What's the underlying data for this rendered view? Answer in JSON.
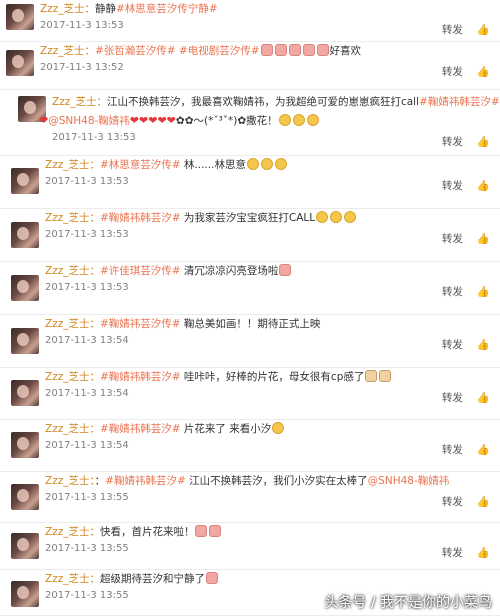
{
  "comments": [
    {
      "name": "Zzz_芝士：",
      "parts": [
        {
          "t": "text",
          "v": "静静"
        },
        {
          "t": "tag",
          "v": "#林思意芸汐传宁静#"
        }
      ],
      "time": "2017-11-3 13:53",
      "repost": "转发",
      "like": "👍"
    },
    {
      "name": "Zzz_芝士：",
      "parts": [
        {
          "t": "tag",
          "v": "#张哲瀚芸汐传# #电视剧芸汐传#"
        },
        {
          "t": "emo",
          "v": "pink"
        },
        {
          "t": "emo",
          "v": "pink"
        },
        {
          "t": "emo",
          "v": "pink"
        },
        {
          "t": "emo",
          "v": "pink"
        },
        {
          "t": "emo",
          "v": "pink"
        },
        {
          "t": "text",
          "v": "好喜欢"
        }
      ],
      "time": "2017-11-3 13:52",
      "repost": "转发",
      "like": "👍"
    },
    {
      "name": "Zzz_芝士：",
      "parts": [
        {
          "t": "text",
          "v": "江山不换韩芸汐，我最喜欢鞠婧祎，为我超绝可爱的崽崽疯狂打call"
        },
        {
          "t": "tag",
          "v": "#鞠婧祎韩芸汐#"
        }
      ],
      "line2": [
        {
          "t": "heart",
          "v": "❤"
        },
        {
          "t": "mention",
          "v": "@SNH48-鞠婧祎"
        },
        {
          "t": "heart",
          "v": "❤❤❤❤❤"
        },
        {
          "t": "text",
          "v": "✿✿～(*ˇ³ˇ*)✿撒花！"
        },
        {
          "t": "emo",
          "v": "y"
        },
        {
          "t": "emo",
          "v": "y"
        },
        {
          "t": "emo",
          "v": "y"
        }
      ],
      "time": "2017-11-3 13:53",
      "repost": "转发",
      "like": "👍"
    },
    {
      "name": "Zzz_芝士：",
      "parts": [
        {
          "t": "tag",
          "v": "#林思意芸汐传#"
        },
        {
          "t": "text",
          "v": " 林......林思意"
        },
        {
          "t": "emo",
          "v": "y"
        },
        {
          "t": "emo",
          "v": "y"
        },
        {
          "t": "emo",
          "v": "y"
        }
      ],
      "time": "2017-11-3 13:53",
      "repost": "转发",
      "like": "👍"
    },
    {
      "name": "Zzz_芝士：",
      "parts": [
        {
          "t": "tag",
          "v": "#鞠婧祎韩芸汐#"
        },
        {
          "t": "text",
          "v": " 为我家芸汐宝宝疯狂打CALL"
        },
        {
          "t": "emo",
          "v": "y"
        },
        {
          "t": "emo",
          "v": "y"
        },
        {
          "t": "emo",
          "v": "y"
        }
      ],
      "time": "2017-11-3 13:53",
      "repost": "转发",
      "like": "👍"
    },
    {
      "name": "Zzz_芝士：",
      "parts": [
        {
          "t": "tag",
          "v": "#许佳琪芸汐传#"
        },
        {
          "t": "text",
          "v": " 清冗凉凉闪亮登场啦"
        },
        {
          "t": "emo",
          "v": "pink"
        }
      ],
      "time": "2017-11-3 13:53",
      "repost": "转发",
      "like": "👍"
    },
    {
      "name": "Zzz_芝士：",
      "parts": [
        {
          "t": "tag",
          "v": "#鞠婧祎芸汐传#"
        },
        {
          "t": "text",
          "v": " 鞠总美如画！！期待正式上映"
        }
      ],
      "time": "2017-11-3 13:54",
      "repost": "转发",
      "like": "👍"
    },
    {
      "name": "Zzz_芝士：",
      "parts": [
        {
          "t": "tag",
          "v": "#鞠婧祎韩芸汐#"
        },
        {
          "t": "text",
          "v": " 哇咔咔，好棒的片花，母女很有cp感了"
        },
        {
          "t": "emo",
          "v": "cat"
        },
        {
          "t": "emo",
          "v": "cat"
        }
      ],
      "time": "2017-11-3 13:54",
      "repost": "转发",
      "like": "👍"
    },
    {
      "name": "Zzz_芝士：",
      "parts": [
        {
          "t": "tag",
          "v": "#鞠婧祎韩芸汐#"
        },
        {
          "t": "text",
          "v": " 片花来了 来看小汐"
        },
        {
          "t": "emo",
          "v": "y"
        }
      ],
      "time": "2017-11-3 13:54",
      "repost": "转发",
      "like": "👍"
    },
    {
      "name": "Zzz_芝士：",
      "parts": [
        {
          "t": "text",
          "v": "："
        },
        {
          "t": "tag",
          "v": "#鞠婧祎韩芸汐#"
        },
        {
          "t": "text",
          "v": " 江山不换韩芸汐，我们小汐实在太棒了"
        },
        {
          "t": "mention",
          "v": "@SNH48-鞠婧祎"
        }
      ],
      "time": "2017-11-3 13:55",
      "repost": "转发",
      "like": "👍"
    },
    {
      "name": "Zzz_芝士：",
      "parts": [
        {
          "t": "text",
          "v": "快看，首片花来啦！"
        },
        {
          "t": "emo",
          "v": "pink"
        },
        {
          "t": "emo",
          "v": "pink"
        }
      ],
      "time": "2017-11-3 13:55",
      "repost": "转发",
      "like": "👍"
    },
    {
      "name": "Zzz_芝士：",
      "parts": [
        {
          "t": "text",
          "v": "超级期待芸汐和宁静了"
        },
        {
          "t": "emo",
          "v": "pink"
        }
      ],
      "time": "2017-11-3 13:55",
      "repost": "",
      "like": ""
    }
  ],
  "watermark": "头条号 / 我不是你的小菜鸟"
}
